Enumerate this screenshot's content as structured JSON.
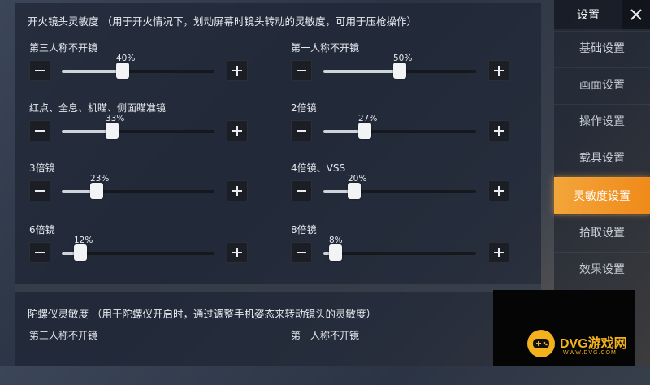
{
  "fire_section": {
    "title": "开火镜头灵敏度 （用于开火情况下，划动屏幕时镜头转动的灵敏度，可用于压枪操作）",
    "settings": [
      {
        "label": "第三人称不开镜",
        "value_text": "40%",
        "value": 0.4
      },
      {
        "label": "第一人称不开镜",
        "value_text": "50%",
        "value": 0.5
      },
      {
        "label": "红点、全息、机瞄、侧面瞄准镜",
        "value_text": "33%",
        "value": 0.33
      },
      {
        "label": "2倍镜",
        "value_text": "27%",
        "value": 0.27
      },
      {
        "label": "3倍镜",
        "value_text": "23%",
        "value": 0.23
      },
      {
        "label": "4倍镜、VSS",
        "value_text": "20%",
        "value": 0.2
      },
      {
        "label": "6倍镜",
        "value_text": "12%",
        "value": 0.12
      },
      {
        "label": "8倍镜",
        "value_text": "8%",
        "value": 0.08
      }
    ]
  },
  "gyro_section": {
    "title": "陀螺仪灵敏度 （用于陀螺仪开启时，通过调整手机姿态来转动镜头的灵敏度）",
    "settings": [
      {
        "label": "第三人称不开镜"
      },
      {
        "label": "第一人称不开镜"
      }
    ]
  },
  "sidebar": {
    "title": "设置",
    "close_icon": "close-icon",
    "items": [
      {
        "label": "基础设置",
        "active": false
      },
      {
        "label": "画面设置",
        "active": false
      },
      {
        "label": "操作设置",
        "active": false
      },
      {
        "label": "载具设置",
        "active": false
      },
      {
        "label": "灵敏度设置",
        "active": true
      },
      {
        "label": "拾取设置",
        "active": false
      },
      {
        "label": "效果设置",
        "active": false
      }
    ]
  },
  "watermark": {
    "brand": "DVG游戏网",
    "url": "WWW.DVG.COM"
  },
  "colors": {
    "accent": "#f08a1a",
    "watermark": "#f3b21d"
  }
}
